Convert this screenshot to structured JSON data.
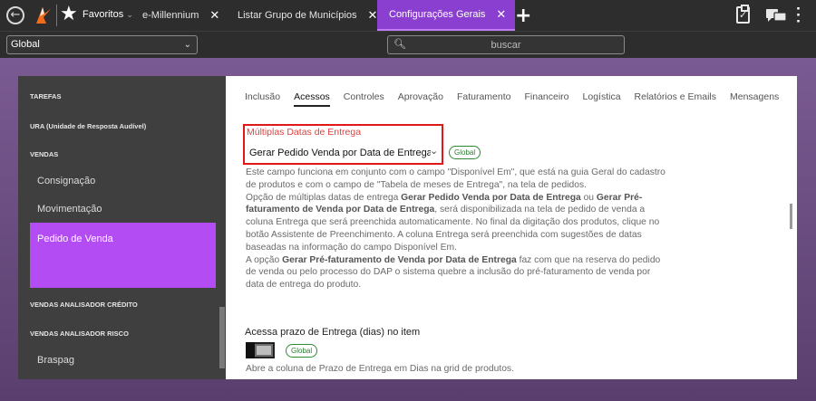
{
  "topbar": {
    "favorites_label": "Favoritos",
    "favorites_chevron": "⌄",
    "tabs": [
      {
        "label": "e-Millennium",
        "close": "✕"
      },
      {
        "label": "Listar Grupo de Municípios",
        "close": "✕"
      },
      {
        "label": "Configurações Gerais",
        "close": "✕",
        "active": true
      }
    ],
    "add_tab": "+",
    "colors": {
      "active_tab": "#8a3fd0",
      "logo_orange": "#f26b1d"
    }
  },
  "context_select": {
    "value": "Global"
  },
  "search": {
    "placeholder": "buscar"
  },
  "sidebar": {
    "sections": [
      {
        "label": "TAREFAS"
      },
      {
        "label": "URA (Unidade de Resposta Audível)"
      },
      {
        "label": "VENDAS"
      },
      {
        "label": "VENDAS ANALISADOR CRÉDITO"
      },
      {
        "label": "VENDAS ANALISADOR RISCO"
      }
    ],
    "items": [
      {
        "label": "Consignação"
      },
      {
        "label": "Movimentação"
      },
      {
        "label": "Pedido de Venda",
        "active": true
      },
      {
        "label": "Braspag"
      }
    ],
    "active_color": "#b44cf4"
  },
  "content_tabs": [
    {
      "label": "Inclusão"
    },
    {
      "label": "Acessos",
      "active": true
    },
    {
      "label": "Controles"
    },
    {
      "label": "Aprovação"
    },
    {
      "label": "Faturamento"
    },
    {
      "label": "Financeiro"
    },
    {
      "label": "Logística"
    },
    {
      "label": "Relatórios e Emails"
    },
    {
      "label": "Mensagens"
    }
  ],
  "setting1": {
    "label": "Múltiplas Datas de Entrega",
    "value": "Gerar Pedido Venda por Data de Entrega",
    "badge": "Global",
    "description": [
      {
        "t": "Este campo funciona em conjunto com o campo \"Disponível Em\", que está na guia Geral do cadastro de produtos e com o campo de \"Tabela de meses de Entrega\", na tela de pedidos."
      },
      {
        "t": "Opção de múltiplas datas de entrega "
      },
      {
        "b": "Gerar Pedido Venda por Data de Entrega"
      },
      {
        "t": " ou "
      },
      {
        "b": "Gerar Pré-faturamento de Venda por Data de Entrega"
      },
      {
        "t": ", será disponibilizada na tela de pedido de venda a coluna Entrega que será preenchida automaticamente. No final da digitação dos produtos, clique no botão Assistente de Preenchimento. A coluna Entrega será preenchida com sugestões de datas baseadas na informação do campo Disponível Em."
      },
      {
        "t": "A opção "
      },
      {
        "b": "Gerar Pré-faturamento de Venda por Data de Entrega"
      },
      {
        "t": " faz com que na reserva do pedido de venda ou pelo processo do DAP o sistema quebre a inclusão do pré-faturamento de venda por data de entrega do produto."
      }
    ],
    "highlight_color": "#e01818"
  },
  "setting2": {
    "label": "Acessa prazo de Entrega (dias) no item",
    "badge": "Global",
    "toggle_on": false,
    "description": "Abre a coluna de Prazo de Entrega em Dias na grid de produtos."
  }
}
